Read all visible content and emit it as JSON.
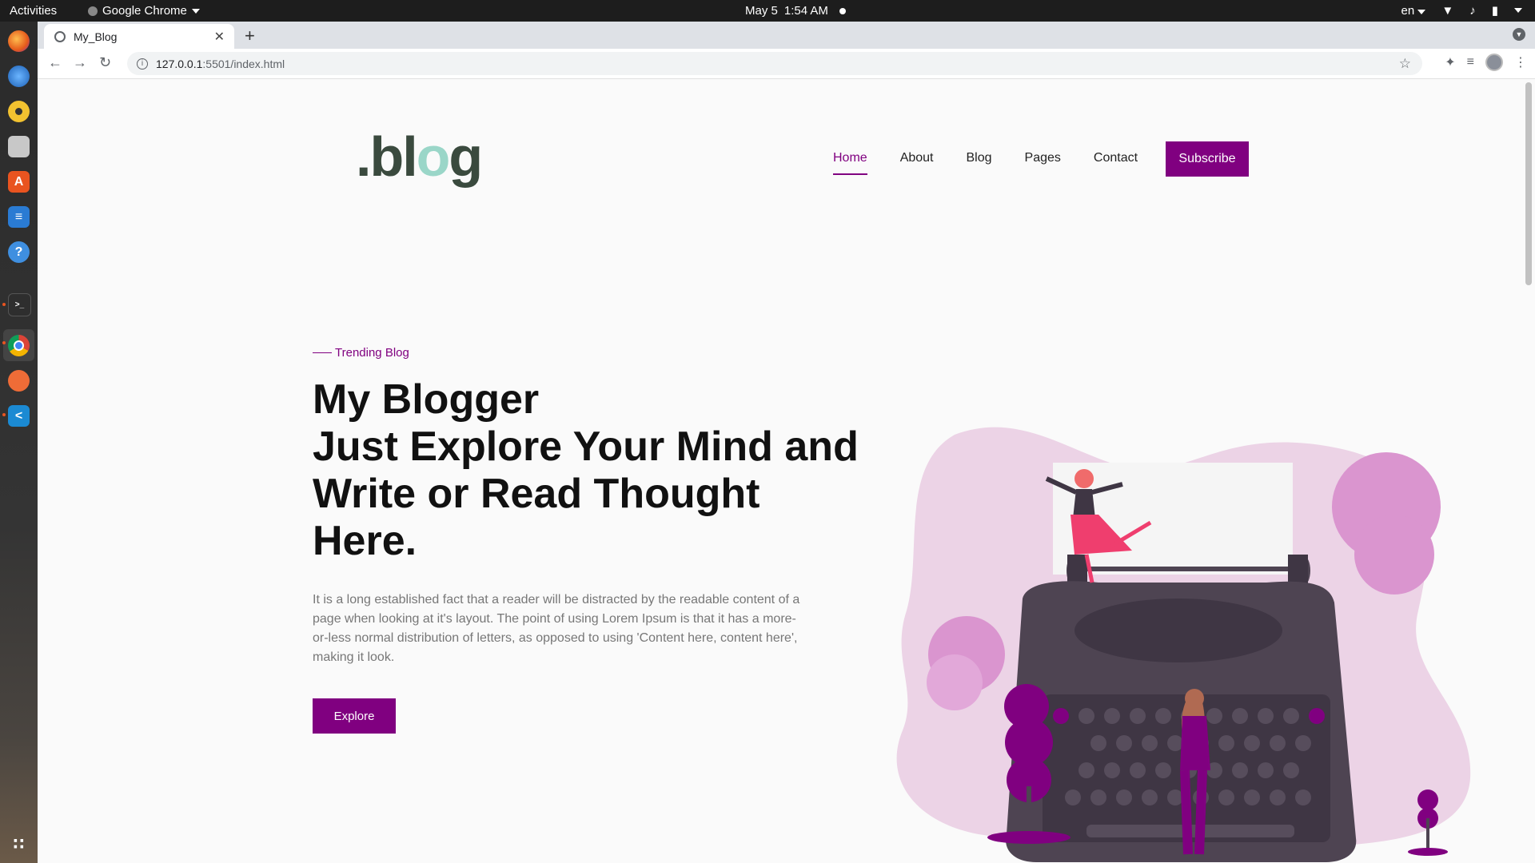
{
  "system_bar": {
    "activities": "Activities",
    "app_name": "Google Chrome",
    "date": "May 5",
    "time": "1:54 AM",
    "language": "en"
  },
  "dock": {
    "apps": [
      "firefox-icon",
      "thunderbird-icon",
      "rhythmbox-icon",
      "files-icon",
      "software-icon",
      "writer-icon",
      "help-icon",
      "terminal-icon",
      "chrome-icon",
      "postman-icon",
      "vscode-icon",
      "app-grid-icon"
    ]
  },
  "browser": {
    "tab_title": "My_Blog",
    "url_host": "127.0.0.1",
    "url_path": ":5501/index.html"
  },
  "site": {
    "logo_prefix": ".bl",
    "logo_o": "o",
    "logo_suffix": "g",
    "nav": [
      "Home",
      "About",
      "Blog",
      "Pages",
      "Contact"
    ],
    "active_nav": "Home",
    "subscribe": "Subscribe",
    "kicker": "Trending Blog",
    "title_lines": [
      "My Blogger",
      "Just Explore Your Mind and",
      "Write or Read Thought",
      "Here."
    ],
    "description": "It is a long established fact that a reader will be distracted by the readable content of a page when looking at it's layout. The point of using Lorem Ipsum is that it has a more-or-less normal distribution of letters, as opposed to using 'Content here, content here', making it look.",
    "explore": "Explore"
  },
  "colors": {
    "accent": "#800080",
    "logo_dark": "#3a4a3e",
    "logo_teal": "#9ad6c8",
    "typewriter": "#4e4452",
    "blob": "#ecd3e6"
  }
}
